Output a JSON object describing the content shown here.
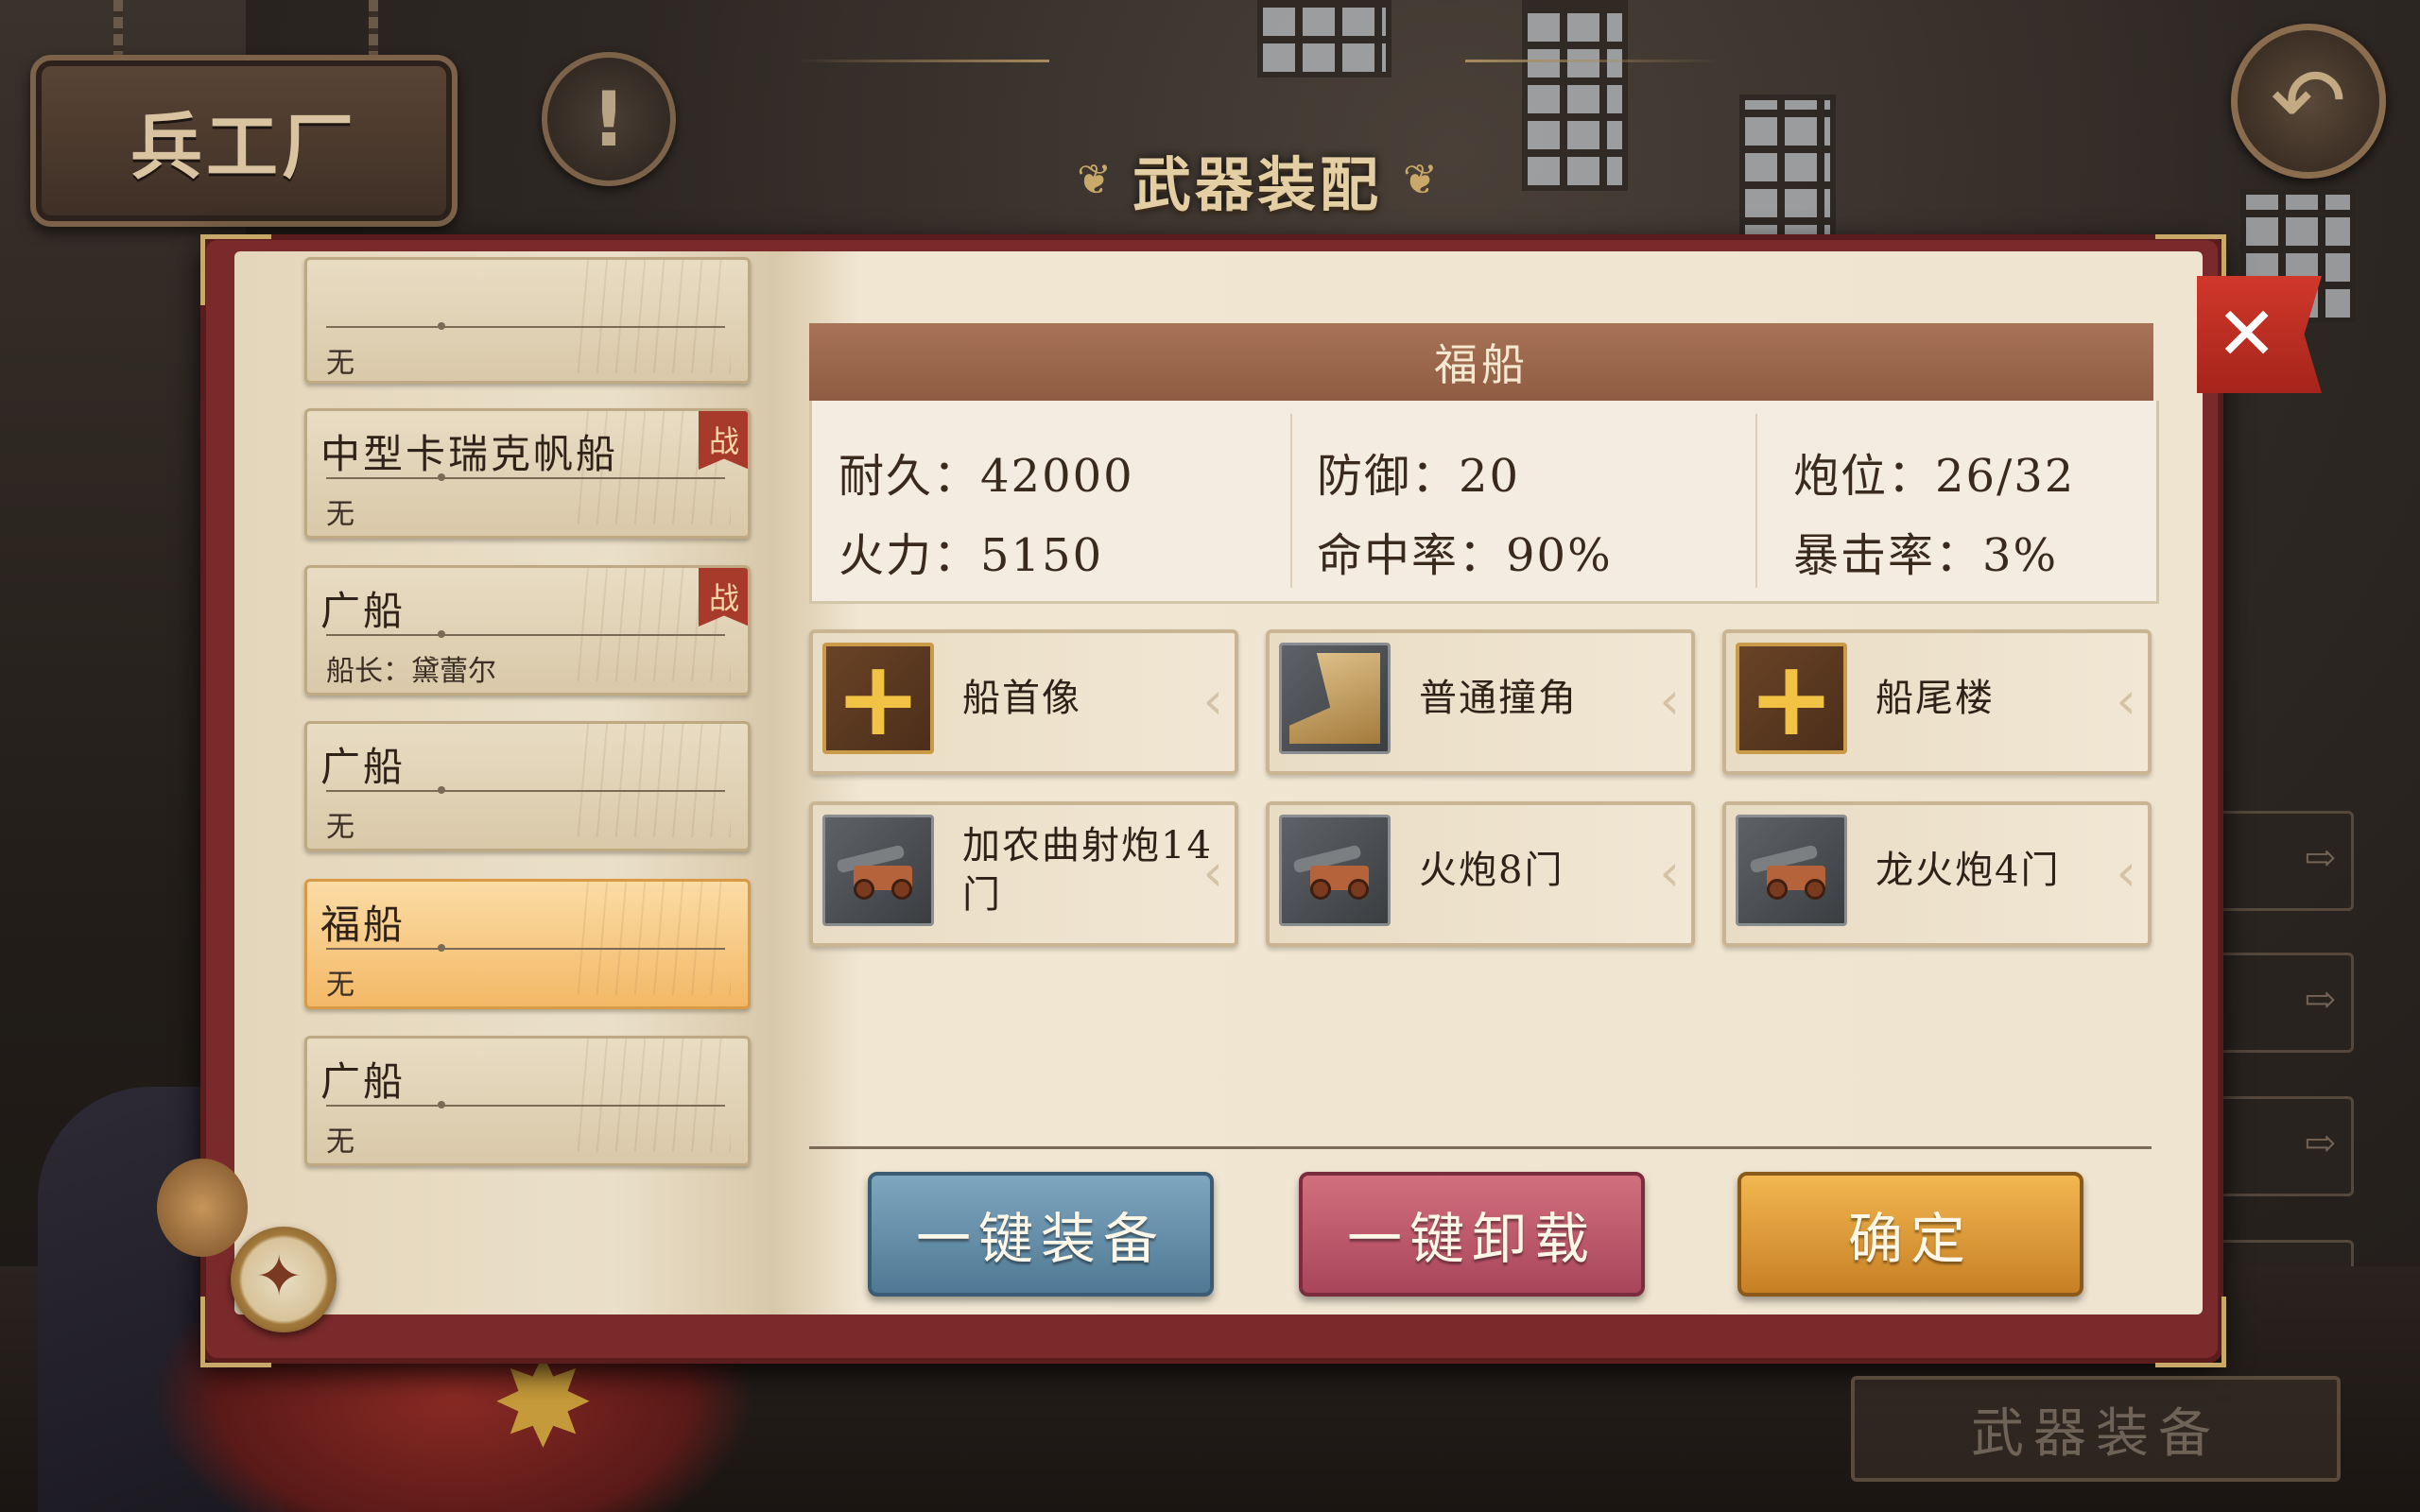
{
  "header": {
    "sign_label": "兵工厂",
    "title": "武器装配"
  },
  "ship_list": [
    {
      "name": "",
      "captain": "无",
      "tag": ""
    },
    {
      "name": "中型卡瑞克帆船",
      "captain": "无",
      "tag": "战"
    },
    {
      "name": "广船",
      "captain": "船长：黛蕾尔",
      "tag": "战"
    },
    {
      "name": "广船",
      "captain": "无",
      "tag": ""
    },
    {
      "name": "福船",
      "captain": "无",
      "tag": "",
      "selected": true
    },
    {
      "name": "广船",
      "captain": "无",
      "tag": ""
    }
  ],
  "ship_detail": {
    "name": "福船",
    "stats": {
      "durability": "耐久：42000",
      "firepower": "火力：5150",
      "defense": "防御：20",
      "accuracy": "命中率：90%",
      "gun_slots": "炮位：26/32",
      "crit_rate": "暴击率：3%"
    }
  },
  "equipment_slots": [
    {
      "label": "船首像",
      "icon": "plus-icon"
    },
    {
      "label": "普通撞角",
      "icon": "ram-icon"
    },
    {
      "label": "船尾楼",
      "icon": "plus-icon"
    },
    {
      "label": "加农曲射炮14门",
      "icon": "cannon-icon"
    },
    {
      "label": "火炮8门",
      "icon": "cannon-icon"
    },
    {
      "label": "龙火炮4门",
      "icon": "cannon-icon"
    }
  ],
  "actions": {
    "equip_all": "一键装备",
    "unequip_all": "一键卸载",
    "confirm": "确定"
  },
  "footer": {
    "weapon_equip": "武器装备"
  },
  "icons": {
    "info": "!",
    "back": "↶",
    "close": "✕"
  },
  "colors": {
    "selected_card": "#f3b866",
    "equip_btn": "#5f88a4",
    "unequip_btn": "#bd5a6c",
    "confirm_btn": "#dc9a3a",
    "header_bar": "#9b664b"
  }
}
